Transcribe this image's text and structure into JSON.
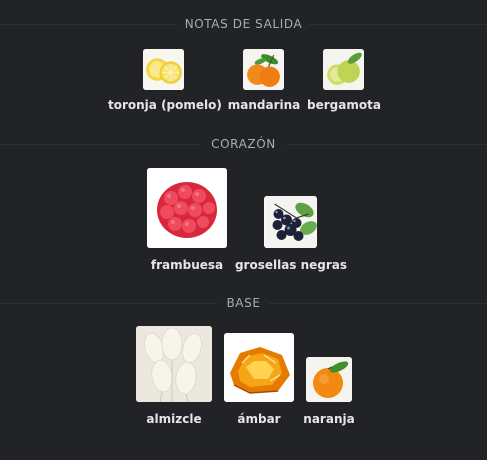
{
  "sections": {
    "top": {
      "title": "NOTAS DE SALIDA",
      "notes": [
        {
          "label": "toronja (pomelo)",
          "icon": "grapefruit-icon"
        },
        {
          "label": "mandarina",
          "icon": "mandarin-icon"
        },
        {
          "label": "bergamota",
          "icon": "bergamot-icon"
        }
      ]
    },
    "heart": {
      "title": "CORAZÓN",
      "notes": [
        {
          "label": "frambuesa",
          "icon": "raspberry-icon"
        },
        {
          "label": "grosellas negras",
          "icon": "blackcurrant-icon"
        }
      ]
    },
    "base": {
      "title": "BASE",
      "notes": [
        {
          "label": "almizcle",
          "icon": "musk-icon"
        },
        {
          "label": "ámbar",
          "icon": "amber-icon"
        },
        {
          "label": "naranja",
          "icon": "orange-icon"
        }
      ]
    }
  },
  "colors": {
    "background": "#222326",
    "section_title": "#a9acb3",
    "note_label": "#e6e6e6",
    "divider": "#2e3034"
  }
}
